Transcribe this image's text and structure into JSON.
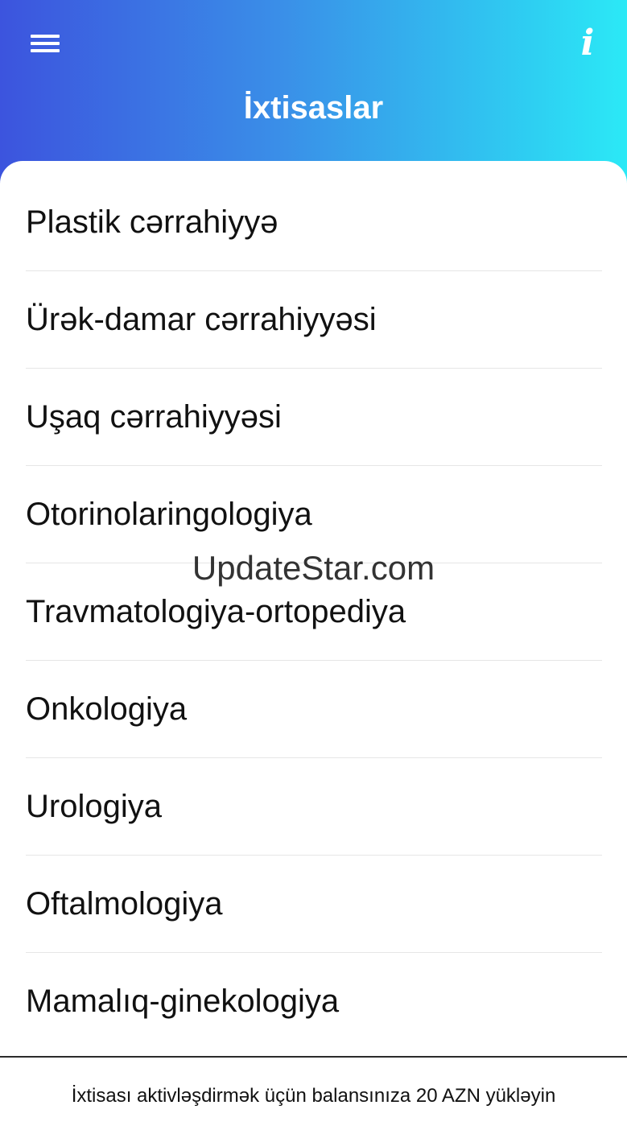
{
  "header": {
    "title": "İxtisaslar",
    "menu_icon": "hamburger-menu-icon",
    "info_icon": "info-icon",
    "info_glyph": "i",
    "gradient_start": "#3c54de",
    "gradient_end": "#2be9f6"
  },
  "specialties": {
    "items": [
      {
        "label": "Plastik cərrahiyyə"
      },
      {
        "label": "Ürək-damar cərrahiyyəsi"
      },
      {
        "label": "Uşaq cərrahiyyəsi"
      },
      {
        "label": "Otorinolaringologiya"
      },
      {
        "label": "Travmatologiya-ortopediya"
      },
      {
        "label": "Onkologiya"
      },
      {
        "label": "Urologiya"
      },
      {
        "label": "Oftalmologiya"
      },
      {
        "label": "Mamalıq-ginekologiya"
      }
    ]
  },
  "watermark": "UpdateStar.com",
  "footer": {
    "notice": "İxtisası aktivləşdirmək üçün balansınıza 20 AZN yükləyin"
  }
}
